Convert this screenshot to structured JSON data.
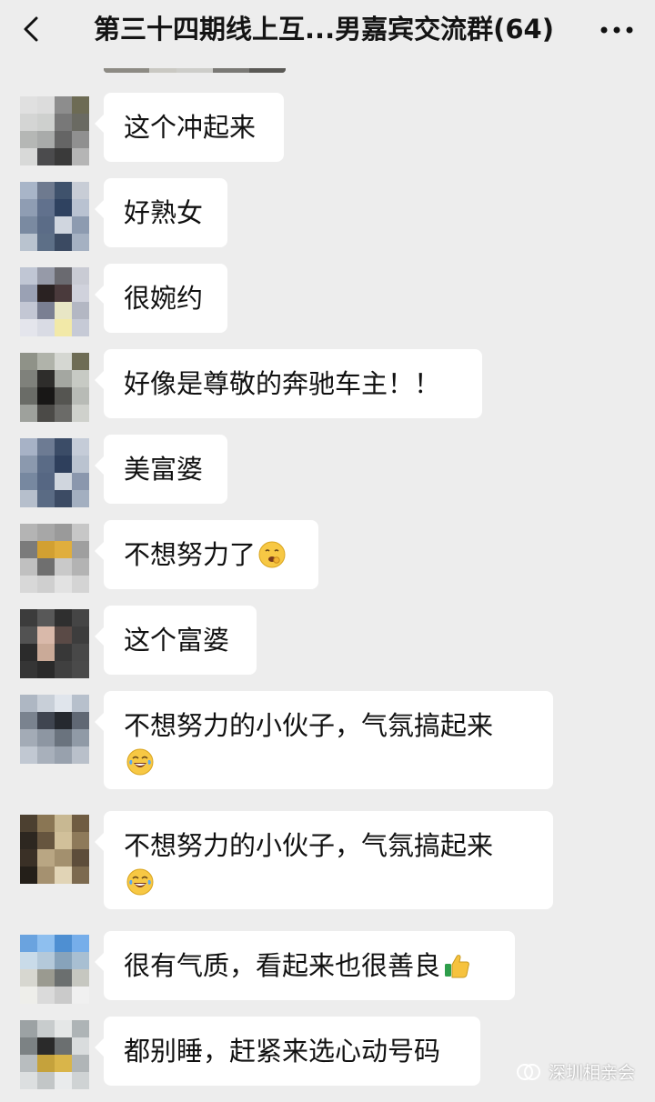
{
  "header": {
    "back_icon": "chevron-left-icon",
    "title": "第三十四期线上互...男嘉宾交流群(64)",
    "more_icon": "more-icon"
  },
  "messages": [
    {
      "text": "这个冲起来",
      "avatar_colors": [
        "#e0e0e0",
        "#dcdcdc",
        "#8d8d8d",
        "#6d6b54",
        "#d4d5d4",
        "#ced0ce",
        "#787878",
        "#6a6a62",
        "#b5b7b5",
        "#a9abaa",
        "#656565",
        "#909090",
        "#d8d9d8",
        "#4b4b4d",
        "#3a3a3a",
        "#b5b5b5"
      ]
    },
    {
      "text": "好熟女",
      "avatar_colors": [
        "#a8b5c8",
        "#6e7a8f",
        "#3f526c",
        "#c8cdd6",
        "#8f9db3",
        "#61718d",
        "#2f4260",
        "#b9c2d1",
        "#7a8aa1",
        "#5b6c87",
        "#d0d6df",
        "#8d9bb0",
        "#b9c3cf",
        "#5d6f87",
        "#3b4a62",
        "#a5b1c2"
      ]
    },
    {
      "text": "很婉约",
      "avatar_colors": [
        "#c0c6d4",
        "#969aa8",
        "#6a6a70",
        "#c9cbd4",
        "#9aa1b4",
        "#2a2222",
        "#4a3a3c",
        "#d0d2dc",
        "#c3c7d4",
        "#7a7f92",
        "#e8e6c5",
        "#b3b7c3",
        "#e4e5ec",
        "#d9dbe4",
        "#f2e9a8",
        "#c6cad6"
      ]
    },
    {
      "text": "好像是尊敬的奔驰车主！！",
      "avatar_colors": [
        "#8f9288",
        "#b0b3aa",
        "#d5d7d2",
        "#6e6c55",
        "#7f817b",
        "#2e2d2b",
        "#a4a7a1",
        "#c7cac4",
        "#6a6c67",
        "#181716",
        "#555551",
        "#b8bbb6",
        "#9ea19c",
        "#4b4a47",
        "#6b6b68",
        "#cfd1cc"
      ]
    },
    {
      "text": "美富婆",
      "avatar_colors": [
        "#a7b2c6",
        "#6d7b93",
        "#3b4c67",
        "#c5ccd8",
        "#8b99ae",
        "#5a6b86",
        "#2e3f5c",
        "#bac3d0",
        "#7788a0",
        "#566783",
        "#d0d6de",
        "#8a97ad",
        "#b6bfcc",
        "#5a6b84",
        "#3c4b64",
        "#a3afc0"
      ]
    },
    {
      "text": "不想努力了",
      "emoji": "yawning-face-emoji",
      "avatar_colors": [
        "#b4b4b4",
        "#a7a7a7",
        "#9a9a9a",
        "#c7c7c7",
        "#7b7b7b",
        "#d2a032",
        "#e0ae3d",
        "#9f9f9f",
        "#c0c0c0",
        "#6f6f6f",
        "#c9c9c9",
        "#b3b3b3",
        "#d8d8d8",
        "#cfcfcf",
        "#e2e2e2",
        "#d4d4d4"
      ]
    },
    {
      "text": "这个富婆",
      "avatar_colors": [
        "#3c3c3c",
        "#585858",
        "#2f2f2f",
        "#454545",
        "#525252",
        "#d9b9aa",
        "#5a4a46",
        "#3d3d3d",
        "#2b2b2b",
        "#caaa98",
        "#383838",
        "#484848",
        "#353535",
        "#2a2a2a",
        "#404040",
        "#4a4a4a"
      ]
    },
    {
      "text": "不想努力的小伙子，气氛搞起来",
      "emoji": "tears-of-joy-emoji",
      "avatar_colors": [
        "#aeb7c3",
        "#c8cfd8",
        "#e0e5ec",
        "#b7c0cc",
        "#7a838f",
        "#3f4550",
        "#25292f",
        "#606874",
        "#a3abb6",
        "#8d96a2",
        "#6a737e",
        "#909aa6",
        "#c1c8d2",
        "#a8b0bb",
        "#98a1ad",
        "#b9c0ca"
      ]
    },
    {
      "text": "不想努力的小伙子，气氛搞起来",
      "emoji": "tears-of-joy-emoji",
      "avatar_colors": [
        "#4c4030",
        "#8a7654",
        "#c8b892",
        "#6f5c42",
        "#2d2720",
        "#66553f",
        "#d1c09a",
        "#8e7a5a",
        "#3a3026",
        "#b9a683",
        "#a3906e",
        "#5d4d3a",
        "#241f19",
        "#a59170",
        "#e1d4b6",
        "#7c6a4f"
      ]
    },
    {
      "text": "很有气质，看起来也很善良",
      "emoji": "thumbs-up-emoji",
      "avatar_colors": [
        "#6aa3df",
        "#8ebfef",
        "#4e8fd2",
        "#76aeea",
        "#c9dbe9",
        "#b4c9da",
        "#87a3bb",
        "#a8bfd2",
        "#d7d7d0",
        "#9a9a90",
        "#6b6f6f",
        "#c6c7c0",
        "#eeeeea",
        "#dadada",
        "#cacaca",
        "#f0f0f0"
      ]
    },
    {
      "text": "都别睡，赶紧来选心动号码",
      "avatar_colors": [
        "#9ca2a4",
        "#c8cccd",
        "#e5e7e7",
        "#aeb4b6",
        "#7c8284",
        "#2a2a2a",
        "#6b6f70",
        "#d9dcdd",
        "#b8bdbf",
        "#c5a23c",
        "#d9b54a",
        "#b0b5b7",
        "#dcdfe0",
        "#c2c6c7",
        "#e9ebec",
        "#cfd3d4"
      ]
    }
  ],
  "watermark": {
    "icon": "wechat-official-account-icon",
    "label": "深圳相亲会"
  }
}
